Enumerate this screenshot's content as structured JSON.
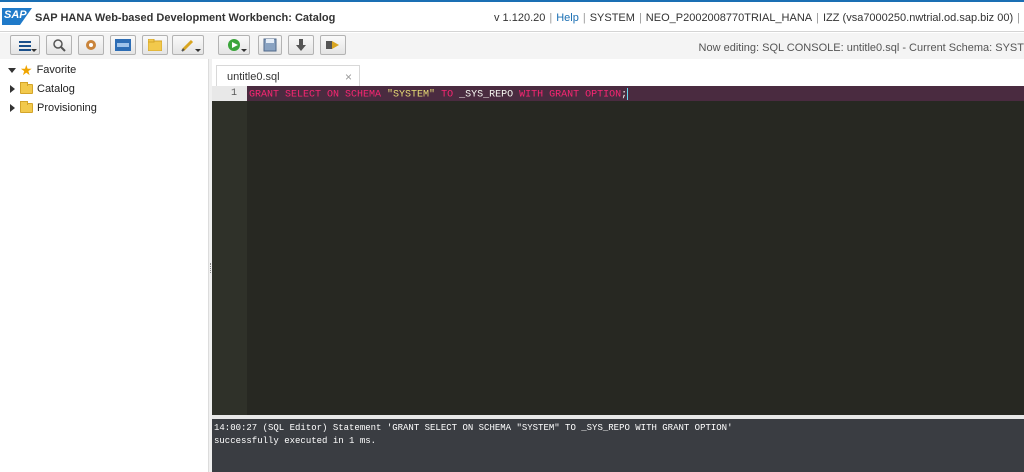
{
  "header": {
    "logo": "SAP",
    "title": "SAP HANA Web-based Development Workbench: Catalog",
    "version": "v 1.120.20",
    "help": "Help",
    "user": "SYSTEM",
    "account": "NEO_P2002008770TRIAL_HANA",
    "host": "IZZ (vsa7000250.nwtrial.od.sap.biz 00)",
    "trailing_sep": "|"
  },
  "toolbar": {
    "buttons": [
      {
        "icon": "menu-icon"
      },
      {
        "icon": "search-icon"
      },
      {
        "icon": "settings-cog-icon"
      },
      {
        "icon": "sql-console-icon"
      },
      {
        "icon": "folder-icon"
      },
      {
        "icon": "pencil-icon"
      },
      {
        "icon": "run-icon"
      },
      {
        "icon": "save-icon"
      },
      {
        "icon": "download-icon"
      },
      {
        "icon": "export-icon"
      }
    ],
    "editing_status": "Now editing: SQL CONSOLE: untitle0.sql - Current Schema: SYST"
  },
  "tree": {
    "items": [
      {
        "label": "Favorite",
        "icon": "star-icon"
      },
      {
        "label": "Catalog",
        "icon": "folder-icon"
      },
      {
        "label": "Provisioning",
        "icon": "folder-icon"
      }
    ]
  },
  "editor": {
    "tab_title": "untitle0.sql",
    "close_glyph": "×",
    "line_number": "1",
    "tokens": {
      "kw1": "GRANT SELECT ON SCHEMA",
      "str1": "\"SYSTEM\"",
      "kw2": "TO",
      "ident1": "_SYS_REPO",
      "kw3": "WITH GRANT OPTION",
      "semi": ";"
    }
  },
  "console": {
    "line1": "14:00:27 (SQL Editor) Statement 'GRANT SELECT ON SCHEMA \"SYSTEM\" TO _SYS_REPO WITH GRANT OPTION'",
    "line2": "successfully executed in 1 ms."
  },
  "colors": {
    "accent": "#1a6fb4",
    "editor_bg": "#272822",
    "keyword": "#f92672",
    "string": "#e6db74"
  }
}
